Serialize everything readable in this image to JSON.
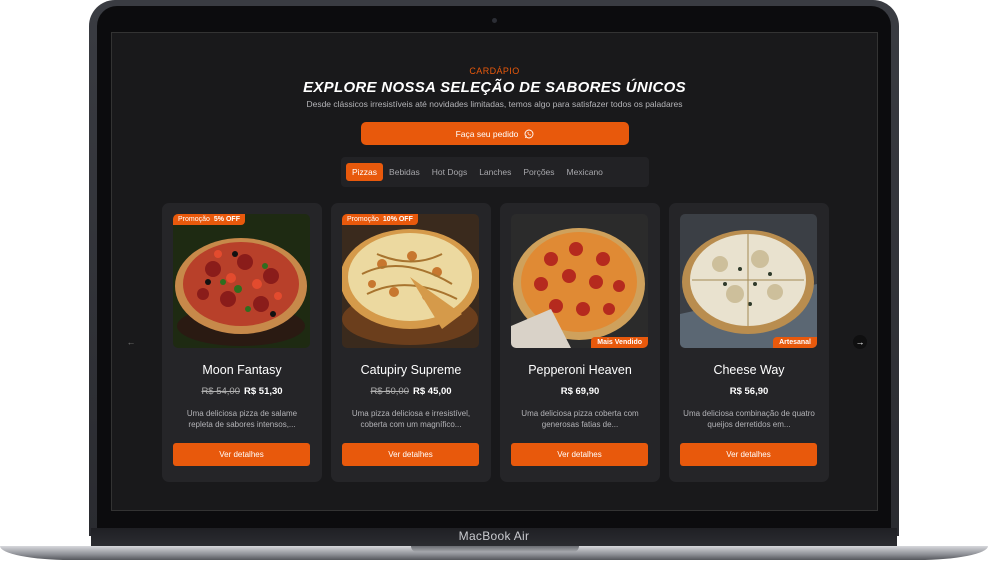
{
  "device": {
    "label": "MacBook Air"
  },
  "header": {
    "eyebrow": "CARDÁPIO",
    "title": "EXPLORE NOSSA SELEÇÃO DE SABORES ÚNICOS",
    "subtitle": "Desde clássicos irresistíveis até novidades limitadas, temos algo para satisfazer todos os paladares",
    "cta_label": "Faça seu pedido"
  },
  "tabs": [
    "Pizzas",
    "Bebidas",
    "Hot Dogs",
    "Lanches",
    "Porções",
    "Mexicano"
  ],
  "active_tab": "Pizzas",
  "cards": [
    {
      "name": "Moon Fantasy",
      "old_price": "R$ 54,00",
      "price": "R$ 51,30",
      "desc": "Uma deliciosa pizza de salame repleta de sabores intensos,...",
      "promo_label": "Promoção",
      "promo_value": "5% OFF",
      "badge": "",
      "button": "Ver detalhes"
    },
    {
      "name": "Catupiry Supreme",
      "old_price": "R$ 50,00",
      "price": "R$ 45,00",
      "desc": "Uma pizza deliciosa e irresistível, coberta com um magnífico...",
      "promo_label": "Promoção",
      "promo_value": "10% OFF",
      "badge": "",
      "button": "Ver detalhes"
    },
    {
      "name": "Pepperoni Heaven",
      "old_price": "",
      "price": "R$ 69,90",
      "desc": "Uma deliciosa pizza coberta com generosas fatias de...",
      "promo_label": "",
      "promo_value": "",
      "badge": "Mais Vendido",
      "button": "Ver detalhes"
    },
    {
      "name": "Cheese Way",
      "old_price": "",
      "price": "R$ 56,90",
      "desc": "Uma deliciosa combinação de quatro queijos derretidos em...",
      "promo_label": "",
      "promo_value": "",
      "badge": "Artesanal",
      "button": "Ver detalhes"
    }
  ],
  "colors": {
    "accent": "#e8590c",
    "background": "#19191b",
    "card": "#252528"
  }
}
